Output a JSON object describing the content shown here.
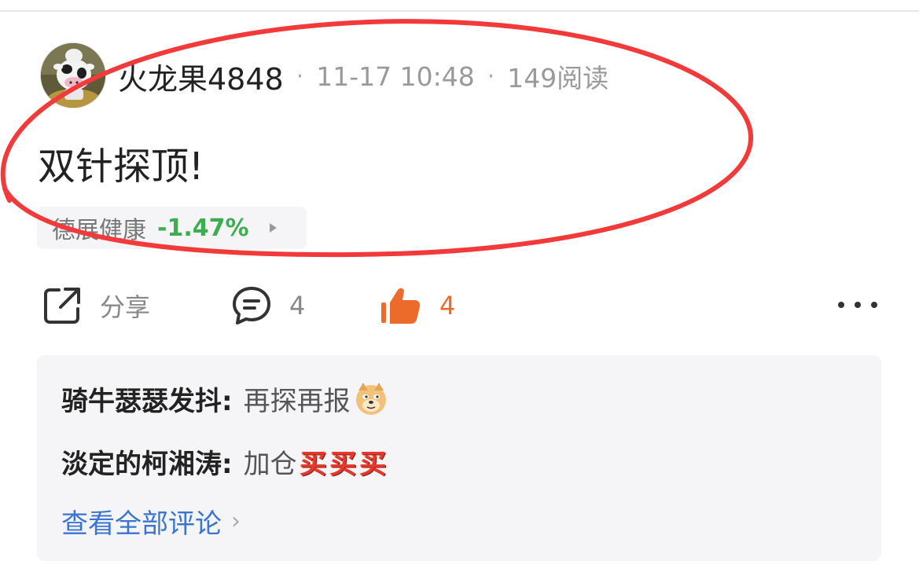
{
  "post": {
    "author": "火龙果4848",
    "time": "11-17 10:48",
    "reads": "149阅读",
    "text": "双针探顶!",
    "stock": {
      "name": "德展健康",
      "change": "-1.47%"
    }
  },
  "actions": {
    "share_label": "分享",
    "comment_count": "4",
    "like_count": "4"
  },
  "comments": [
    {
      "author": "骑牛瑟瑟发抖:",
      "text": "再探再报",
      "emoji": "doge-icon"
    },
    {
      "author": "淡定的柯湘涛:",
      "text": "加仓",
      "emoji": "买"
    }
  ],
  "view_all_label": "查看全部评论",
  "colors": {
    "annotation": "#f23a3a",
    "like": "#ec6a2a",
    "stock_down": "#3cae4f",
    "link": "#3a76d1",
    "panel_bg": "#f5f5f7"
  }
}
